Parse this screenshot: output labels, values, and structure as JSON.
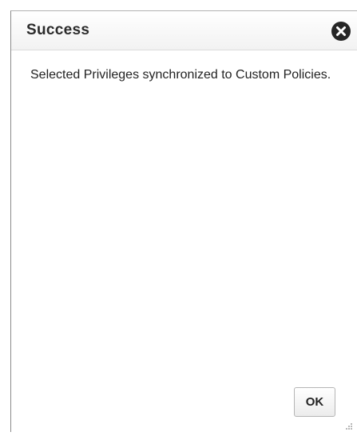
{
  "dialog": {
    "title": "Success",
    "message": "Selected Privileges synchronized to Custom Policies.",
    "ok_label": "OK",
    "close_icon": "close-icon",
    "resize_icon": "resize-grip-icon"
  },
  "colors": {
    "title_text": "#2b2b2b",
    "close_icon_bg": "#262626",
    "border": "#8a8a8a"
  }
}
